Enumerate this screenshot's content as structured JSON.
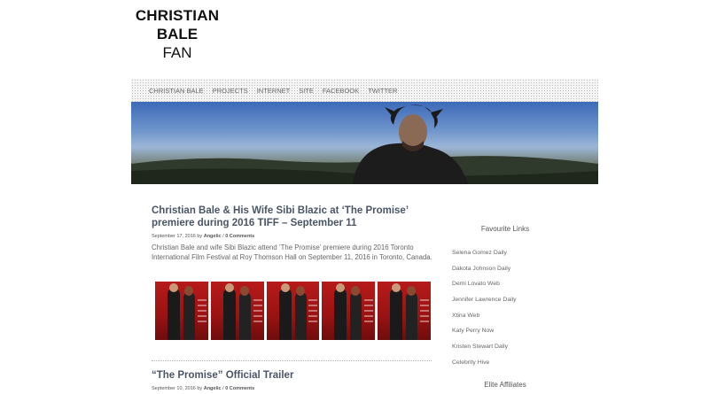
{
  "site": {
    "logo_line1": "CHRISTIAN",
    "logo_line2": "BALE",
    "logo_line3": "FAN"
  },
  "nav": {
    "items": [
      {
        "label": "CHRISTIAN BALE"
      },
      {
        "label": "PROJECTS"
      },
      {
        "label": "INTERNET"
      },
      {
        "label": "SITE"
      },
      {
        "label": "FACEBOOK"
      },
      {
        "label": "TWITTER"
      }
    ]
  },
  "posts": [
    {
      "title": "Christian Bale & His Wife Sibi Blazic at ‘The Promise’ premiere during 2016 TIFF – September 11",
      "date": "September 17, 2016",
      "by": "by",
      "author": "Angelic",
      "comments": "0 Comments",
      "excerpt": "Christian Bale and wife Sibi Blazic attend ‘The Promise’ premiere during 2016 Toronto International Film Festival at Roy Thomson Hall on September 11, 2016 in Toronto, Canada."
    },
    {
      "title": "“The Promise” Official Trailer",
      "date": "September 10, 2016",
      "by": "by",
      "author": "Angelic",
      "comments": "0 Comments"
    }
  ],
  "sidebar": {
    "favourite_title": "Favourite Links",
    "links": [
      {
        "label": "Selena Gomez Daily"
      },
      {
        "label": "Dakota Johnson Daily"
      },
      {
        "label": "Demi Lovato Web"
      },
      {
        "label": "Jennifer Lawrence Daily"
      },
      {
        "label": "Xtina Web"
      },
      {
        "label": "Katy Perry Now"
      },
      {
        "label": "Kristen Stewart Daily"
      },
      {
        "label": "Celebrity Hive"
      }
    ],
    "affiliates_title": "Elite Affiliates"
  }
}
